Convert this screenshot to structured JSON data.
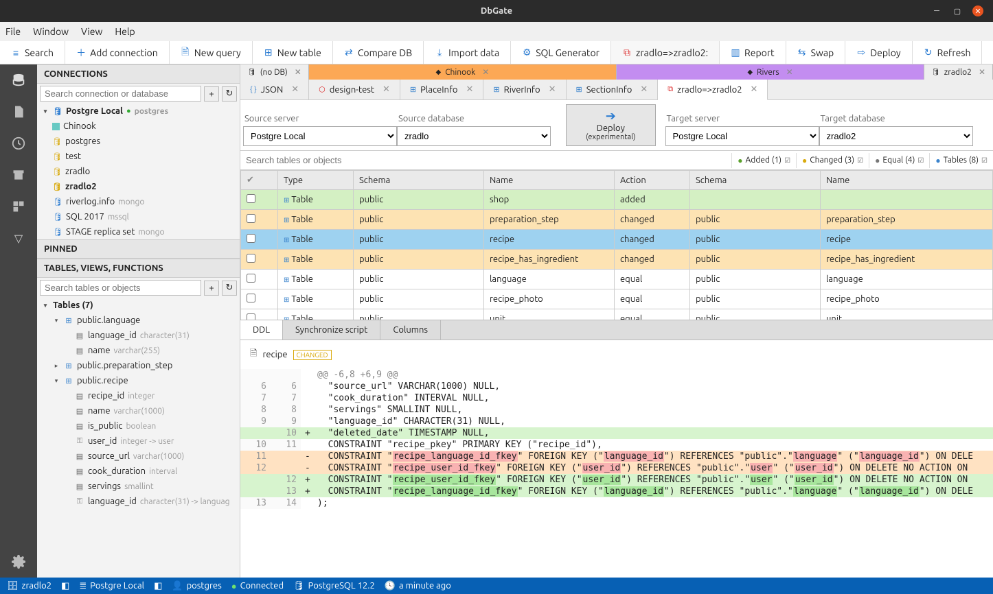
{
  "titlebar": {
    "title": "DbGate"
  },
  "menubar": [
    "File",
    "Window",
    "View",
    "Help"
  ],
  "toolbar": [
    {
      "id": "search",
      "label": "Search",
      "icon": "menu"
    },
    {
      "id": "addconn",
      "label": "Add connection",
      "icon": "plus"
    },
    {
      "id": "newquery",
      "label": "New query",
      "icon": "doc"
    },
    {
      "id": "newtable",
      "label": "New table",
      "icon": "table"
    },
    {
      "id": "comparedb",
      "label": "Compare DB",
      "icon": "compare"
    },
    {
      "id": "importdata",
      "label": "Import data",
      "icon": "import"
    },
    {
      "id": "sqlgen",
      "label": "SQL Generator",
      "icon": "gear"
    },
    {
      "id": "compare-active",
      "label": "zradlo=>zradlo2:",
      "icon": "diff",
      "active": true
    },
    {
      "id": "report",
      "label": "Report",
      "icon": "report"
    },
    {
      "id": "swap",
      "label": "Swap",
      "icon": "swap"
    },
    {
      "id": "deploy",
      "label": "Deploy",
      "icon": "deploy"
    },
    {
      "id": "refresh",
      "label": "Refresh",
      "icon": "refresh"
    }
  ],
  "sidebar": {
    "connections_header": "CONNECTIONS",
    "search_placeholder": "Search connection or database",
    "connections": [
      {
        "label": "Postgre Local",
        "sub": "postgres",
        "bold": true,
        "icon": "db",
        "exp": "▾",
        "status": "ok"
      },
      {
        "label": "Chinook",
        "icon": "cube",
        "ind": 1,
        "cube": "#67c9c3"
      },
      {
        "label": "postgres",
        "icon": "cyl",
        "ind": 1
      },
      {
        "label": "test",
        "icon": "cyl",
        "ind": 1
      },
      {
        "label": "zradlo",
        "icon": "cyl",
        "ind": 1
      },
      {
        "label": "zradlo2",
        "icon": "cyl",
        "ind": 1,
        "bold": true
      },
      {
        "label": "riverlog.info",
        "sub": "mongo",
        "icon": "db",
        "exp": ""
      },
      {
        "label": "SQL 2017",
        "sub": "mssql",
        "icon": "db",
        "exp": ""
      },
      {
        "label": "STAGE replica set",
        "sub": "mongo",
        "icon": "db",
        "exp": ""
      }
    ],
    "pinned_header": "PINNED",
    "tables_header": "TABLES, VIEWS, FUNCTIONS",
    "tables_search_placeholder": "Search tables or objects",
    "tree": [
      {
        "exp": "▾",
        "label": "Tables (7)",
        "bold": true,
        "ind": 0
      },
      {
        "exp": "▾",
        "icon": "table",
        "label": "public.language",
        "ind": 1
      },
      {
        "icon": "col",
        "label": "language_id",
        "type": "character(31)",
        "ind": 2
      },
      {
        "icon": "col",
        "label": "name",
        "type": "varchar(255)",
        "ind": 2
      },
      {
        "exp": "▸",
        "icon": "table",
        "label": "public.preparation_step",
        "ind": 1
      },
      {
        "exp": "▾",
        "icon": "table",
        "label": "public.recipe",
        "ind": 1
      },
      {
        "icon": "col",
        "label": "recipe_id",
        "type": "integer",
        "ind": 2
      },
      {
        "icon": "col",
        "label": "name",
        "type": "varchar(1000)",
        "ind": 2
      },
      {
        "icon": "col",
        "label": "is_public",
        "type": "boolean",
        "ind": 2
      },
      {
        "icon": "key",
        "label": "user_id",
        "type": "integer -> user",
        "ind": 2
      },
      {
        "icon": "col",
        "label": "source_url",
        "type": "varchar(1000)",
        "ind": 2
      },
      {
        "icon": "col",
        "label": "cook_duration",
        "type": "interval",
        "ind": 2
      },
      {
        "icon": "col",
        "label": "servings",
        "type": "smallint",
        "ind": 2
      },
      {
        "icon": "key",
        "label": "language_id",
        "type": "character(31) -> languag",
        "ind": 2
      }
    ]
  },
  "top_tabs": [
    {
      "label": "(no DB)",
      "cls": "grey",
      "icon": "cyl"
    },
    {
      "label": "Chinook",
      "cls": "orange",
      "icon": "cube"
    },
    {
      "label": "Rivers",
      "cls": "purple",
      "icon": "cube"
    },
    {
      "label": "zradlo2",
      "cls": "grey",
      "icon": "cyl"
    }
  ],
  "sub_tabs": [
    {
      "label": "JSON",
      "icon": "{}"
    },
    {
      "label": "design-test",
      "icon": "diag"
    },
    {
      "label": "PlaceInfo",
      "icon": "table"
    },
    {
      "label": "RiverInfo",
      "icon": "table"
    },
    {
      "label": "SectionInfo",
      "icon": "table"
    },
    {
      "label": "zradlo=>zradlo2",
      "icon": "diff",
      "active": true
    }
  ],
  "compare": {
    "src_server_label": "Source server",
    "src_server": "Postgre Local",
    "src_db_label": "Source database",
    "src_db": "zradlo",
    "tgt_server_label": "Target server",
    "tgt_server": "Postgre Local",
    "tgt_db_label": "Target database",
    "tgt_db": "zradlo2",
    "deploy_btn": "Deploy",
    "deploy_sub": "(experimental)",
    "search_placeholder": "Search tables or objects",
    "badges": [
      {
        "id": "added",
        "label": "Added (1)",
        "color": "#5aa02c"
      },
      {
        "id": "changed",
        "label": "Changed (3)",
        "color": "#d9aa0d"
      },
      {
        "id": "equal",
        "label": "Equal (4)",
        "color": "#777"
      },
      {
        "id": "tables",
        "label": "Tables (8)",
        "color": "#3a83cc"
      }
    ],
    "columns": [
      "",
      "Type",
      "Schema",
      "Name",
      "Action",
      "Schema",
      "Name"
    ],
    "rows": [
      {
        "cls": "row-added",
        "type": "Table",
        "schema1": "public",
        "name1": "shop",
        "action": "added",
        "schema2": "",
        "name2": ""
      },
      {
        "cls": "row-changed",
        "type": "Table",
        "schema1": "public",
        "name1": "preparation_step",
        "action": "changed",
        "schema2": "public",
        "name2": "preparation_step"
      },
      {
        "cls": "row-selected",
        "type": "Table",
        "schema1": "public",
        "name1": "recipe",
        "action": "changed",
        "schema2": "public",
        "name2": "recipe"
      },
      {
        "cls": "row-changed",
        "type": "Table",
        "schema1": "public",
        "name1": "recipe_has_ingredient",
        "action": "changed",
        "schema2": "public",
        "name2": "recipe_has_ingredient"
      },
      {
        "cls": "",
        "type": "Table",
        "schema1": "public",
        "name1": "language",
        "action": "equal",
        "schema2": "public",
        "name2": "language"
      },
      {
        "cls": "",
        "type": "Table",
        "schema1": "public",
        "name1": "recipe_photo",
        "action": "equal",
        "schema2": "public",
        "name2": "recipe_photo"
      },
      {
        "cls": "",
        "type": "Table",
        "schema1": "public",
        "name1": "unit",
        "action": "equal",
        "schema2": "public",
        "name2": "unit"
      }
    ],
    "ddl_tabs": [
      "DDL",
      "Synchronize script",
      "Columns"
    ],
    "diff_object": "recipe",
    "diff_badge": "CHANGED",
    "hunk": "@@ -6,8 +6,9 @@",
    "lines": [
      {
        "l": "6",
        "r": "6",
        "s": " ",
        "t": "  \"source_url\" VARCHAR(1000) NULL,"
      },
      {
        "l": "7",
        "r": "7",
        "s": " ",
        "t": "  \"cook_duration\" INTERVAL NULL,"
      },
      {
        "l": "8",
        "r": "8",
        "s": " ",
        "t": "  \"servings\" SMALLINT NULL,"
      },
      {
        "l": "9",
        "r": "9",
        "s": " ",
        "t": "  \"language_id\" CHARACTER(31) NULL,"
      },
      {
        "l": "",
        "r": "10",
        "s": "+",
        "cls": "line-add",
        "t": "  \"deleted_date\" TIMESTAMP NULL,"
      },
      {
        "l": "10",
        "r": "11",
        "s": " ",
        "t": "  CONSTRAINT \"recipe_pkey\" PRIMARY KEY (\"recipe_id\"),"
      },
      {
        "l": "11",
        "r": "",
        "s": "-",
        "cls": "line-del",
        "html": "  CONSTRAINT \"<span class='hl-del'>recipe_language_id_fkey</span>\" FOREIGN KEY (\"<span class='hl-del'>language_id</span>\") REFERENCES \"public\".\"<span class='hl-del'>language</span>\" (\"<span class='hl-del'>language_id</span>\") ON DELE"
      },
      {
        "l": "12",
        "r": "",
        "s": "-",
        "cls": "line-del",
        "html": "  CONSTRAINT \"<span class='hl-del'>recipe_user_id_fkey</span>\" FOREIGN KEY (\"<span class='hl-del'>user_id</span>\") REFERENCES \"public\".\"<span class='hl-del'>user</span>\" (\"<span class='hl-del'>user_id</span>\") ON DELETE NO ACTION ON "
      },
      {
        "l": "",
        "r": "12",
        "s": "+",
        "cls": "line-add",
        "html": "  CONSTRAINT \"<span class='hl-add'>recipe_user_id_fkey</span>\" FOREIGN KEY (\"<span class='hl-add'>user_id</span>\") REFERENCES \"public\".\"<span class='hl-add'>user</span>\" (\"<span class='hl-add'>user_id</span>\") ON DELETE NO ACTION ON "
      },
      {
        "l": "",
        "r": "13",
        "s": "+",
        "cls": "line-add",
        "html": "  CONSTRAINT \"<span class='hl-add'>recipe_language_id_fkey</span>\" FOREIGN KEY (\"<span class='hl-add'>language_id</span>\") REFERENCES \"public\".\"<span class='hl-add'>language</span>\" (\"<span class='hl-add'>language_id</span>\") ON DELE"
      },
      {
        "l": "13",
        "r": "14",
        "s": " ",
        "t": ");"
      }
    ]
  },
  "statusbar": {
    "db": "zradlo2",
    "server": "Postgre Local",
    "user": "postgres",
    "status": "Connected",
    "engine": "PostgreSQL 12.2",
    "time": "a minute ago"
  }
}
